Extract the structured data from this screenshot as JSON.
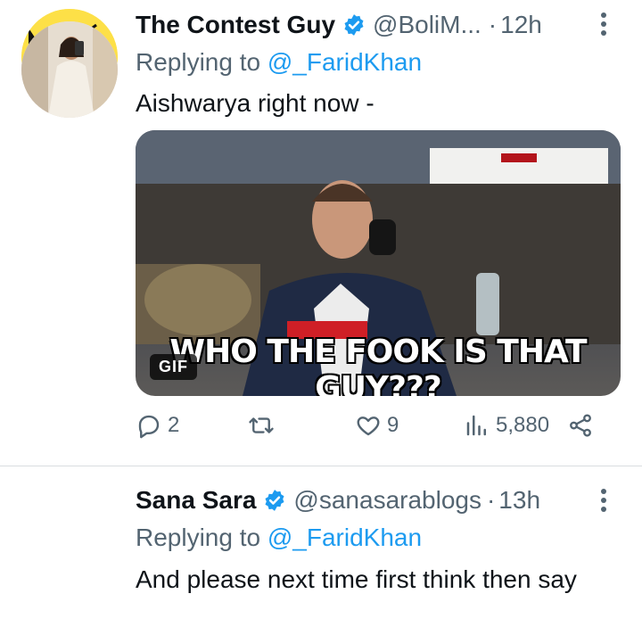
{
  "tweets": [
    {
      "author": "The Contest Guy",
      "handle": "@BoliM...",
      "time": "12h",
      "replying_prefix": "Replying to",
      "replying_to": "@_FaridKhan",
      "text": "Aishwarya right now -",
      "media": {
        "badge": "GIF",
        "caption": "WHO THE FOOK IS THAT GUY???"
      },
      "stats": {
        "replies": "2",
        "retweets": "",
        "likes": "9",
        "views": "5,880"
      }
    },
    {
      "author": "Sana Sara",
      "handle": "@sanasarablogs",
      "time": "13h",
      "replying_prefix": "Replying to",
      "replying_to": "@_FaridKhan",
      "text": "And please next time first think then say"
    }
  ],
  "icons": {
    "verified": "verified-badge-icon",
    "more": "more-options-icon",
    "reply": "reply-icon",
    "retweet": "retweet-icon",
    "like": "heart-icon",
    "views": "views-icon",
    "share": "share-icon"
  },
  "colors": {
    "accent": "#1d9bf0",
    "secondary_text": "#536471",
    "primary_text": "#0f1419"
  }
}
